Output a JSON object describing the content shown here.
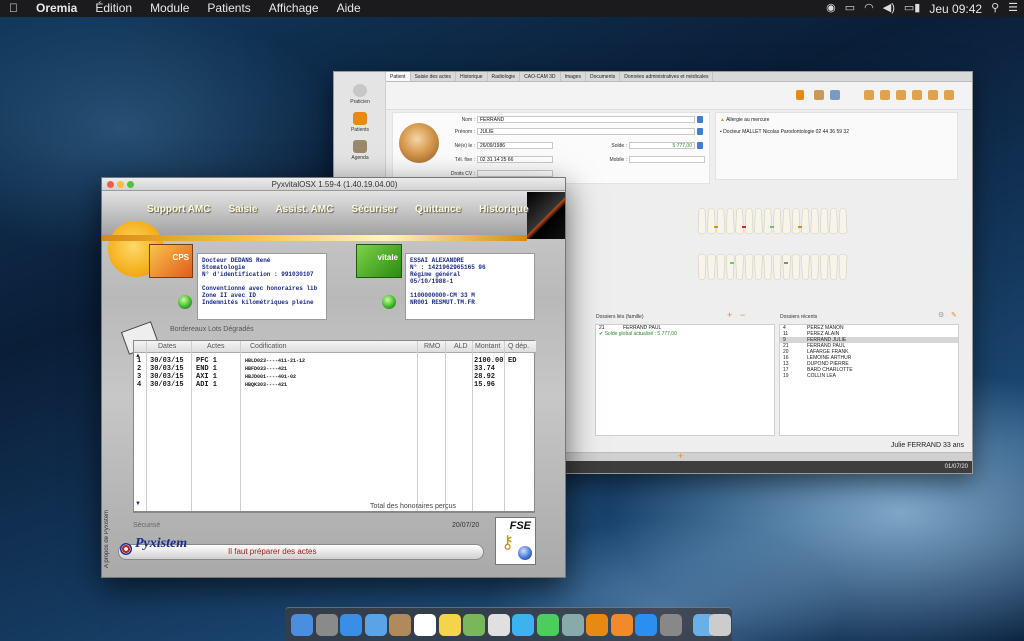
{
  "menubar": {
    "apple": "",
    "app": "Oremia",
    "items": [
      "Édition",
      "Module",
      "Patients",
      "Affichage",
      "Aide"
    ],
    "clock": "Jeu 09:42"
  },
  "oremia": {
    "sidebar": [
      "Praticien",
      "Patients",
      "Agenda"
    ],
    "tabs": [
      "Patient",
      "Saisie des actes",
      "Historique",
      "Radiologie",
      "CAO-CAM 3D",
      "Images",
      "Documents",
      "Données administratives et médicales"
    ],
    "form": {
      "nom_label": "Nom :",
      "nom": "FERRAND",
      "prenom_label": "Prénom :",
      "prenom": "JULIE",
      "ne_label": "Né(e) le :",
      "ne": "26/09/1986",
      "tel_label": "Tél. fixe :",
      "tel": "02 31 14 25 66",
      "droits_label": "Droits CV :",
      "solde_label": "Solde :",
      "solde": "5 777,00",
      "mobile_label": "Mobile :"
    },
    "alert": {
      "allergy": "Allergie au mercure",
      "doctor": "Docteur MALLET Nicolas Parodontologie 02 44 36 59 32"
    },
    "famille": {
      "title": "Dossiers liés (famille)",
      "rows": [
        {
          "n": "21",
          "name": "FERRAND PAUL"
        }
      ],
      "balance": "Solde global actualisé : 5 777,00"
    },
    "recents": {
      "title": "Dossiers récents",
      "rows": [
        {
          "n": "4",
          "name": "PEREZ MANON"
        },
        {
          "n": "11",
          "name": "PEREZ ALAIN"
        },
        {
          "n": "9",
          "name": "FERRAND JULIE"
        },
        {
          "n": "21",
          "name": "FERRAND PAUL"
        },
        {
          "n": "20",
          "name": "LAFARGE FRANK"
        },
        {
          "n": "16",
          "name": "LEMOINE ARTHUR"
        },
        {
          "n": "13",
          "name": "DUPOND PIERRE"
        },
        {
          "n": "17",
          "name": "BARD CHARLOTTE"
        },
        {
          "n": "19",
          "name": "COLLIN LEA"
        }
      ]
    },
    "patient_summary": "Julie FERRAND 33 ans",
    "status_date": "01/07/20",
    "colors": {
      "accent": "#3c7fd4",
      "orange": "#e88a12"
    }
  },
  "pyx": {
    "title": "PyxvitalOSX  1.59-4 (1.40.19.04.00)",
    "menu": [
      "Support AMC",
      "Saisie",
      "Assist. AMC",
      "Sécuriser",
      "Quittance",
      "Historique"
    ],
    "cps": {
      "logo": "CPS",
      "lines": [
        "Docteur DEDANS René",
        "Stomatologie",
        "N° d'identification : 991030107",
        "",
        "Conventionné avec honoraires lib",
        "Zone II avec ID",
        "Indemnités kilométriques pleine"
      ]
    },
    "vitale": {
      "logo": "vitale",
      "lines": [
        "ESSAI ALEXANDRE",
        "N° : 1421962965165 96",
        "Régime général",
        "05/10/1988-1",
        "",
        "1100000000-CM 33 M",
        "NR001 RESMUT.TM.FR"
      ]
    },
    "bordereau": "Bordereaux Lots Dégradés",
    "table": {
      "headers": [
        "Dates",
        "Actes",
        "Codification",
        "RMO",
        "ALD",
        "Montant",
        "Q dép."
      ],
      "rows": [
        {
          "n": "1",
          "date": "30/03/15",
          "acte": "PFC 1",
          "code": "HBLD023----411-21-12",
          "montant": "2100.00",
          "q": "ED"
        },
        {
          "n": "2",
          "date": "30/03/15",
          "acte": "END 1",
          "code": "HBFD033----421",
          "montant": "33.74",
          "q": ""
        },
        {
          "n": "3",
          "date": "30/03/15",
          "acte": "AXI 1",
          "code": "HBJD001----401-02",
          "montant": "28.92",
          "q": ""
        },
        {
          "n": "4",
          "date": "30/03/15",
          "acte": "ADI 1",
          "code": "HBQK303----421",
          "montant": "15.96",
          "q": ""
        }
      ]
    },
    "total_label": "Total des honoraires perçus",
    "status": "Sécurisé",
    "date": "20/07/20",
    "brand": "Pyxistem",
    "message": "Il faut préparer des actes",
    "side": "A propos de Pyxistem",
    "fse": "FSE"
  },
  "dock_icons": [
    "finder-icon",
    "launchpad-icon",
    "safari-icon",
    "mail-icon",
    "contacts-icon",
    "calendar-icon",
    "notes-icon",
    "maps-icon",
    "photos-icon",
    "messages-icon",
    "facetime-icon",
    "preview-icon",
    "oremia-icon",
    "books-icon",
    "appstore-icon",
    "preferences-icon",
    "folder-icon",
    "trash-icon"
  ]
}
